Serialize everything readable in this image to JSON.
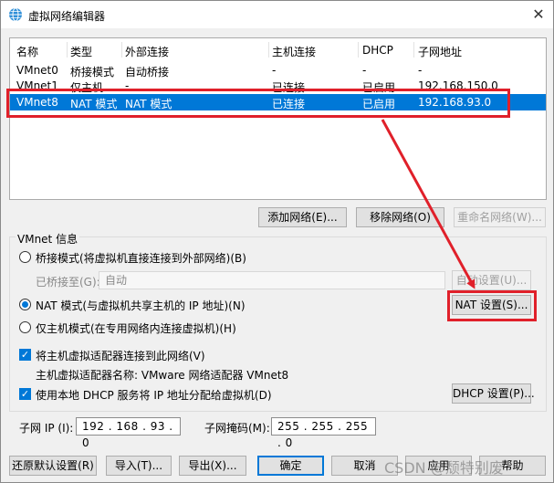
{
  "window": {
    "title": "虚拟网络编辑器",
    "close_glyph": "✕",
    "accent": "#0078d7",
    "annotation_color": "#e0202a"
  },
  "table": {
    "headers": [
      "名称",
      "类型",
      "外部连接",
      "主机连接",
      "DHCP",
      "子网地址"
    ],
    "rows": [
      [
        "VMnet0",
        "桥接模式",
        "自动桥接",
        "-",
        "-",
        "-"
      ],
      [
        "VMnet1",
        "仅主机...",
        "-",
        "已连接",
        "已启用",
        "192.168.150.0"
      ],
      [
        "VMnet8",
        "NAT 模式",
        "NAT 模式",
        "已连接",
        "已启用",
        "192.168.93.0"
      ]
    ],
    "selected_row": 2
  },
  "net_buttons": {
    "add": "添加网络(E)...",
    "remove": "移除网络(O)",
    "rename": "重命名网络(W)..."
  },
  "vmnet_info": {
    "group_label": "VMnet 信息",
    "bridged_label": "桥接模式(将虚拟机直接连接到外部网络)(B)",
    "bridged_to_label": "已桥接至(G):",
    "bridged_to_value": "自动",
    "auto_settings": "自动设置(U)...",
    "nat_label": "NAT 模式(与虚拟机共享主机的 IP 地址)(N)",
    "nat_settings": "NAT 设置(S)...",
    "hostonly_label": "仅主机模式(在专用网络内连接虚拟机)(H)",
    "connect_adapter_label": "将主机虚拟适配器连接到此网络(V)",
    "adapter_name_label": "主机虚拟适配器名称: VMware 网络适配器 VMnet8",
    "use_dhcp_label": "使用本地 DHCP 服务将 IP 地址分配给虚拟机(D)",
    "dhcp_settings": "DHCP 设置(P)...",
    "subnet_ip_label": "子网 IP (I):",
    "subnet_ip": "192 . 168 . 93 . 0",
    "subnet_mask_label": "子网掩码(M):",
    "subnet_mask": "255 . 255 . 255 . 0"
  },
  "footer": {
    "restore": "还原默认设置(R)",
    "import": "导入(T)...",
    "export": "导出(X)...",
    "ok": "确定",
    "cancel": "取消",
    "apply": "应用",
    "help": "帮助"
  },
  "watermark": "CSDN @颓特别废"
}
